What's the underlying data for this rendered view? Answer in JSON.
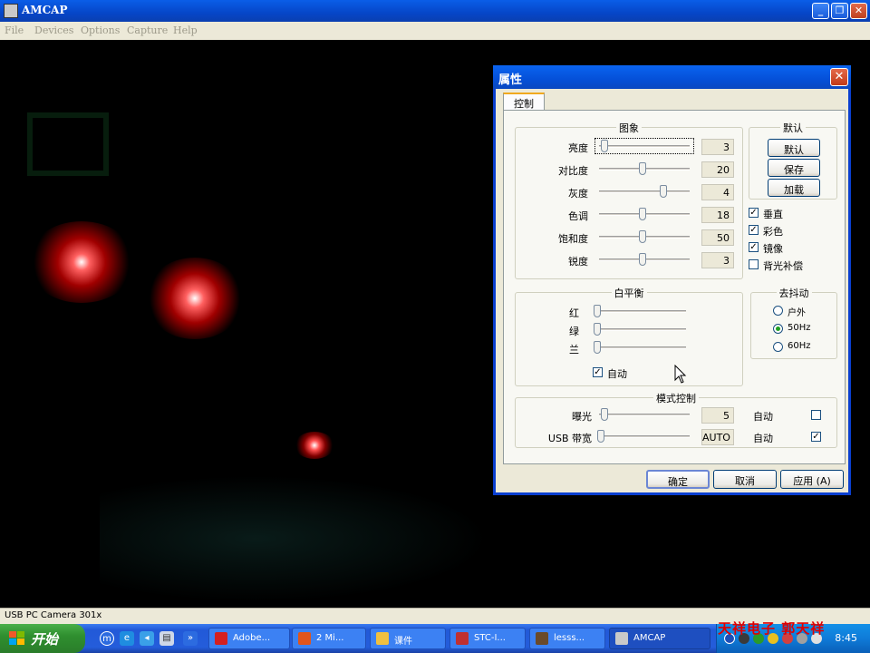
{
  "app": {
    "title": "AMCAP",
    "menu": [
      "File",
      "Devices",
      "Options",
      "Capture",
      "Help"
    ],
    "window_buttons": [
      "_",
      "❐",
      "✕"
    ],
    "status": "USB PC Camera 301x"
  },
  "dialog": {
    "title": "属性",
    "close": "✕",
    "tab": "控制",
    "image_group": {
      "title": "图象",
      "rows": [
        {
          "label": "亮度",
          "value": "3",
          "level": 0.04
        },
        {
          "label": "对比度",
          "value": "20",
          "level": 0.48
        },
        {
          "label": "灰度",
          "value": "4",
          "level": 0.72
        },
        {
          "label": "色调",
          "value": "18",
          "level": 0.48
        },
        {
          "label": "饱和度",
          "value": "50",
          "level": 0.48
        },
        {
          "label": "锐度",
          "value": "3",
          "level": 0.48
        }
      ]
    },
    "default_group": {
      "title": "默认",
      "buttons": [
        "默认",
        "保存",
        "加载"
      ]
    },
    "checks": [
      {
        "label": "垂直",
        "checked": true
      },
      {
        "label": "彩色",
        "checked": true
      },
      {
        "label": "镜像",
        "checked": true
      },
      {
        "label": "背光补偿",
        "checked": false
      }
    ],
    "wb_group": {
      "title": "白平衡",
      "rows": [
        {
          "label": "红",
          "level": 0.0
        },
        {
          "label": "绿",
          "level": 0.0
        },
        {
          "label": "兰",
          "level": 0.0
        }
      ],
      "auto_label": "自动",
      "auto_checked": true
    },
    "flicker_group": {
      "title": "去抖动",
      "options": [
        {
          "label": "户外",
          "selected": false
        },
        {
          "label": "50Hz",
          "selected": true
        },
        {
          "label": "60Hz",
          "selected": false
        }
      ]
    },
    "mode_group": {
      "title": "模式控制",
      "rows": [
        {
          "label": "曝光",
          "value": "5",
          "level": 0.04,
          "auto_label": "自动",
          "auto_checked": false
        },
        {
          "label": "USB 带宽",
          "value": "AUTO",
          "level": 0.0,
          "auto_label": "自动",
          "auto_checked": true
        }
      ]
    },
    "footer": {
      "ok": "确定",
      "cancel": "取消",
      "apply": "应用 (A)"
    }
  },
  "taskbar": {
    "start": "开始",
    "tasks": [
      "Adobe...",
      "2 Mi...",
      "课件",
      "STC-I...",
      "lesss...",
      "AMCAP"
    ],
    "clock": "8:45",
    "watermark": "天祥电子 郭天祥"
  },
  "colors": {
    "titlebar": "#0a5ee8",
    "dialog_face": "#ece9d8",
    "taskbar": "#245ddb",
    "start": "#2f8f2f",
    "watermark": "#e00000"
  }
}
